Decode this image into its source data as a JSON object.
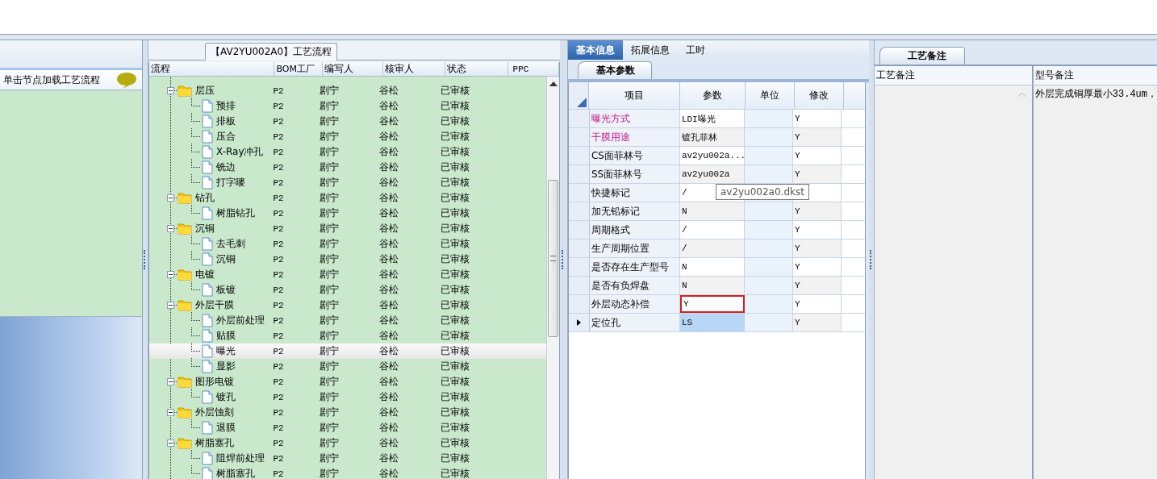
{
  "left_panel": {
    "hint": "单击节点加载工艺流程"
  },
  "flow_panel": {
    "title": "【AV2YU002A0】工艺流程",
    "columns": [
      "流程",
      "BOM工厂",
      "编写人",
      "核审人",
      "状态",
      "PPC"
    ],
    "rows": [
      {
        "name": "层压",
        "kind": "folder",
        "expanded": true,
        "bom": "P2",
        "writer": "剧宁",
        "reviewer": "谷松",
        "status": "已审核",
        "selected": false,
        "children": [
          {
            "name": "预排",
            "kind": "file",
            "bom": "P2",
            "writer": "剧宁",
            "reviewer": "谷松",
            "status": "已审核",
            "selected": false
          },
          {
            "name": "排板",
            "kind": "file",
            "bom": "P2",
            "writer": "剧宁",
            "reviewer": "谷松",
            "status": "已审核",
            "selected": false
          },
          {
            "name": "压合",
            "kind": "file",
            "bom": "P2",
            "writer": "剧宁",
            "reviewer": "谷松",
            "status": "已审核",
            "selected": false
          },
          {
            "name": "X-Ray冲孔",
            "kind": "file",
            "bom": "P2",
            "writer": "剧宁",
            "reviewer": "谷松",
            "status": "已审核",
            "selected": false
          },
          {
            "name": "铣边",
            "kind": "file",
            "bom": "P2",
            "writer": "剧宁",
            "reviewer": "谷松",
            "status": "已审核",
            "selected": false
          },
          {
            "name": "打字嘜",
            "kind": "file",
            "bom": "P2",
            "writer": "剧宁",
            "reviewer": "谷松",
            "status": "已审核",
            "selected": false
          }
        ]
      },
      {
        "name": "钻孔",
        "kind": "folder",
        "expanded": true,
        "bom": "P2",
        "writer": "剧宁",
        "reviewer": "谷松",
        "status": "已审核",
        "selected": false,
        "children": [
          {
            "name": "树脂钻孔",
            "kind": "file",
            "bom": "P2",
            "writer": "剧宁",
            "reviewer": "谷松",
            "status": "已审核",
            "selected": false
          }
        ]
      },
      {
        "name": "沉铜",
        "kind": "folder",
        "expanded": true,
        "bom": "P2",
        "writer": "剧宁",
        "reviewer": "谷松",
        "status": "已审核",
        "selected": false,
        "children": [
          {
            "name": "去毛刺",
            "kind": "file",
            "bom": "P2",
            "writer": "剧宁",
            "reviewer": "谷松",
            "status": "已审核",
            "selected": false
          },
          {
            "name": "沉铜",
            "kind": "file",
            "bom": "P2",
            "writer": "剧宁",
            "reviewer": "谷松",
            "status": "已审核",
            "selected": false
          }
        ]
      },
      {
        "name": "电镀",
        "kind": "folder",
        "expanded": true,
        "bom": "P2",
        "writer": "剧宁",
        "reviewer": "谷松",
        "status": "已审核",
        "selected": false,
        "children": [
          {
            "name": "板镀",
            "kind": "file",
            "bom": "P2",
            "writer": "剧宁",
            "reviewer": "谷松",
            "status": "已审核",
            "selected": false
          }
        ]
      },
      {
        "name": "外层干膜",
        "kind": "folder",
        "expanded": true,
        "bom": "P2",
        "writer": "剧宁",
        "reviewer": "谷松",
        "status": "已审核",
        "selected": false,
        "children": [
          {
            "name": "外层前处理",
            "kind": "file",
            "bom": "P2",
            "writer": "剧宁",
            "reviewer": "谷松",
            "status": "已审核",
            "selected": false
          },
          {
            "name": "贴膜",
            "kind": "file",
            "bom": "P2",
            "writer": "剧宁",
            "reviewer": "谷松",
            "status": "已审核",
            "selected": false
          },
          {
            "name": "曝光",
            "kind": "file",
            "bom": "P2",
            "writer": "剧宁",
            "reviewer": "谷松",
            "status": "已审核",
            "selected": true
          },
          {
            "name": "显影",
            "kind": "file",
            "bom": "P2",
            "writer": "剧宁",
            "reviewer": "谷松",
            "status": "已审核",
            "selected": false
          }
        ]
      },
      {
        "name": "图形电镀",
        "kind": "folder",
        "expanded": true,
        "bom": "P2",
        "writer": "剧宁",
        "reviewer": "谷松",
        "status": "已审核",
        "selected": false,
        "children": [
          {
            "name": "镀孔",
            "kind": "file",
            "bom": "P2",
            "writer": "剧宁",
            "reviewer": "谷松",
            "status": "已审核",
            "selected": false
          }
        ]
      },
      {
        "name": "外层蚀刻",
        "kind": "folder",
        "expanded": true,
        "bom": "P2",
        "writer": "剧宁",
        "reviewer": "谷松",
        "status": "已审核",
        "selected": false,
        "children": [
          {
            "name": "退膜",
            "kind": "file",
            "bom": "P2",
            "writer": "剧宁",
            "reviewer": "谷松",
            "status": "已审核",
            "selected": false
          }
        ]
      },
      {
        "name": "树脂塞孔",
        "kind": "folder",
        "expanded": true,
        "bom": "P2",
        "writer": "剧宁",
        "reviewer": "谷松",
        "status": "已审核",
        "selected": false,
        "children": [
          {
            "name": "阻焊前处理",
            "kind": "file",
            "bom": "P2",
            "writer": "剧宁",
            "reviewer": "谷松",
            "status": "已审核",
            "selected": false
          },
          {
            "name": "树脂塞孔",
            "kind": "file",
            "bom": "P2",
            "writer": "剧宁",
            "reviewer": "谷松",
            "status": "已审核",
            "selected": false
          }
        ]
      }
    ]
  },
  "tabs": [
    {
      "label": "基本信息",
      "selected": true
    },
    {
      "label": "拓展信息",
      "selected": false
    },
    {
      "label": "工时",
      "selected": false
    }
  ],
  "params_panel": {
    "tab": "基本参数",
    "columns": [
      "项目",
      "参数",
      "单位",
      "修改"
    ],
    "rows": [
      {
        "item": "曝光方式",
        "value": "LDI曝光",
        "modified": "Y",
        "emphasis": true,
        "current": false,
        "flagged": false
      },
      {
        "item": "干膜用途",
        "value": "镀孔菲林",
        "modified": "Y",
        "emphasis": true,
        "current": false,
        "flagged": false
      },
      {
        "item": "CS面菲林号",
        "value": "av2yu002a...",
        "modified": "Y",
        "emphasis": false,
        "current": false,
        "flagged": false
      },
      {
        "item": "SS面菲林号",
        "value": "av2yu002a",
        "modified": "Y",
        "emphasis": false,
        "current": false,
        "flagged": false
      },
      {
        "item": "快捷标记",
        "value": "/",
        "emphasis": false,
        "current": false,
        "flagged": false
      },
      {
        "item": "加无铅标记",
        "value": "N",
        "modified": "Y",
        "emphasis": false,
        "current": false,
        "flagged": false
      },
      {
        "item": "周期格式",
        "value": "/",
        "modified": "Y",
        "emphasis": false,
        "current": false,
        "flagged": false
      },
      {
        "item": "生产周期位置",
        "value": "/",
        "modified": "Y",
        "emphasis": false,
        "current": false,
        "flagged": false
      },
      {
        "item": "是否存在生产型号",
        "value": "N",
        "modified": "Y",
        "emphasis": false,
        "current": false,
        "flagged": false
      },
      {
        "item": "是否有负焊盘",
        "value": "N",
        "modified": "Y",
        "emphasis": false,
        "current": false,
        "flagged": false
      },
      {
        "item": "外层动态补偿",
        "value": "Y",
        "modified": "Y",
        "emphasis": false,
        "current": false,
        "flagged": true
      },
      {
        "item": "定位孔",
        "value": "LS",
        "modified": "Y",
        "emphasis": false,
        "current": true,
        "flagged": false
      }
    ],
    "tooltip": "av2yu002a0.dkst"
  },
  "notes_panel": {
    "tab": "工艺备注",
    "columns": [
      "工艺备注",
      "型号备注"
    ],
    "model_note": "外层完成铜厚最小33.4um，"
  }
}
